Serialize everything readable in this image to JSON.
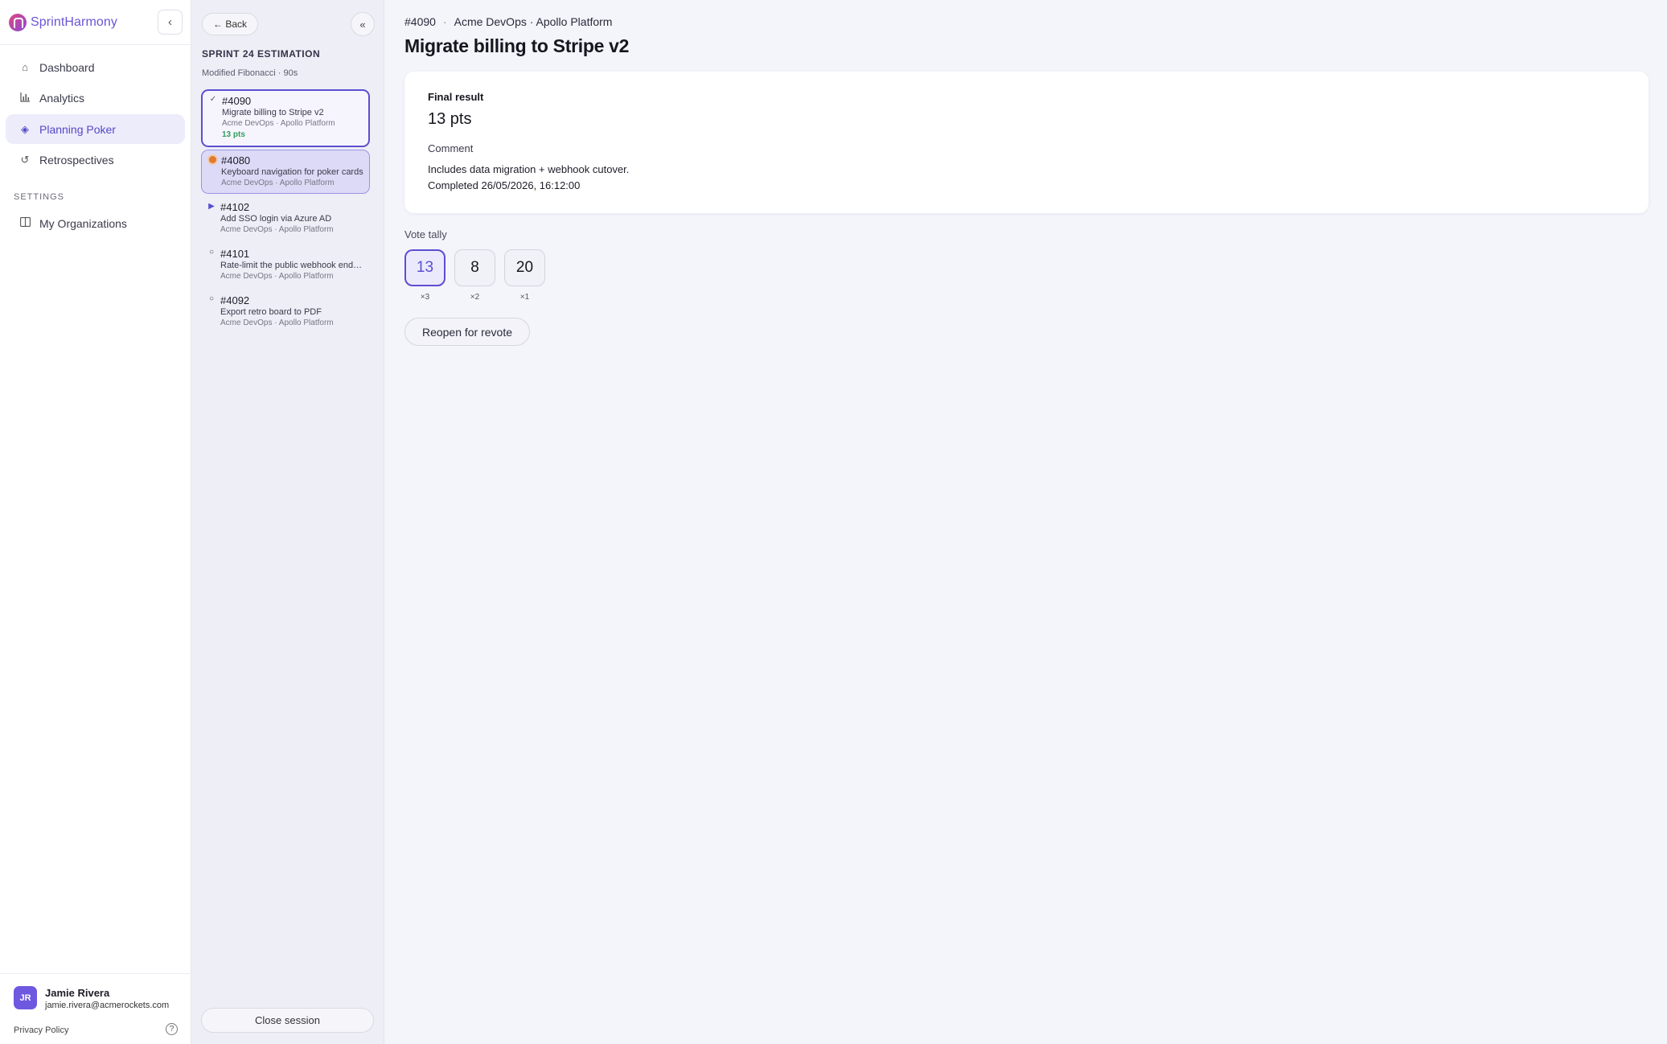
{
  "app": {
    "name": "SprintHarmony",
    "collapse_icon": "‹"
  },
  "nav": {
    "items": [
      {
        "label": "Dashboard",
        "icon": "⌂"
      },
      {
        "label": "Analytics",
        "icon": "📊"
      },
      {
        "label": "Planning Poker",
        "icon": "◈"
      },
      {
        "label": "Retrospectives",
        "icon": "↺"
      }
    ],
    "settings_heading": "SETTINGS",
    "settings_items": [
      {
        "label": "My Organizations",
        "icon": "▣"
      }
    ]
  },
  "user": {
    "initials": "JR",
    "name": "Jamie Rivera",
    "email": "jamie.rivera@acmerockets.com",
    "privacy": "Privacy Policy",
    "help_icon": "?"
  },
  "panel": {
    "back": "← Back",
    "collapse_icon": "«",
    "session_title": "SPRINT 24 ESTIMATION",
    "session_meta": "Modified Fibonacci · 90s",
    "close_session": "Close session"
  },
  "stories": [
    {
      "id": "#4090",
      "title": "Migrate billing to Stripe v2",
      "org": "Acme DevOps · Apollo Platform",
      "points": "13 pts",
      "status": "done",
      "status_icon": "✓"
    },
    {
      "id": "#4080",
      "title": "Keyboard navigation for poker cards",
      "org": "Acme DevOps · Apollo Platform",
      "points": "",
      "status": "voting",
      "status_icon": "●"
    },
    {
      "id": "#4102",
      "title": "Add SSO login via Azure AD",
      "org": "Acme DevOps · Apollo Platform",
      "points": "",
      "status": "next",
      "status_icon": "▶"
    },
    {
      "id": "#4101",
      "title": "Rate-limit the public webhook endpoint",
      "org": "Acme DevOps · Apollo Platform",
      "points": "",
      "status": "pending",
      "status_icon": "○"
    },
    {
      "id": "#4092",
      "title": "Export retro board to PDF",
      "org": "Acme DevOps · Apollo Platform",
      "points": "",
      "status": "pending",
      "status_icon": "○"
    }
  ],
  "main": {
    "breadcrumb_id": "#4090",
    "breadcrumb_sep": "·",
    "breadcrumb_org": "Acme DevOps · Apollo Platform",
    "title": "Migrate billing to Stripe v2",
    "final_label": "Final result",
    "final_value": "13 pts",
    "comment_label": "Comment",
    "comment_text": "Includes data migration + webhook cutover.",
    "completed_text": "Completed 26/05/2026, 16:12:00",
    "tally_label": "Vote tally",
    "tally": [
      {
        "value": "13",
        "count": "×3"
      },
      {
        "value": "8",
        "count": "×2"
      },
      {
        "value": "20",
        "count": "×1"
      }
    ],
    "reopen": "Reopen for revote"
  },
  "colors": {
    "accent": "#5a4fd0",
    "points_green": "#2f9e5a",
    "voting_orange": "#e07a2e",
    "next_blue": "#5a4fd0"
  }
}
